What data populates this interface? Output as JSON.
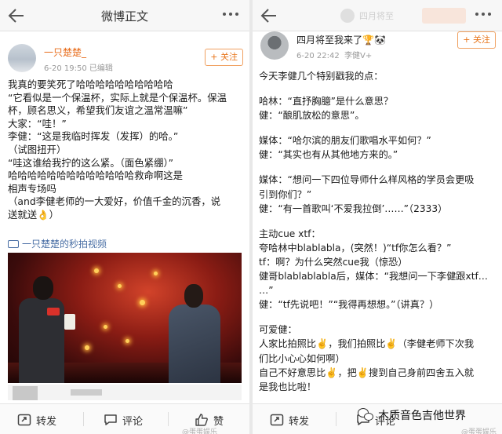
{
  "left": {
    "header": {
      "title": "微博正文"
    },
    "author": {
      "name": "一只楚楚_",
      "time": "6-20 19:50",
      "edited": "已编辑",
      "follow": "+ 关注"
    },
    "post_lines": [
      "我真的要笑死了哈哈哈哈哈哈哈哈哈哈",
      "“它看似是一个保温杯，实际上就是个保温杯。保温",
      "杯，顾名思义，希望我们友谊之温常温嘛”",
      "大家：“哇！”",
      "李健：“这是我临时挥发（发挥）的哈。”",
      "（试图扭开）",
      "“哇这谁给我拧的这么紧。（面色紧绷）”",
      "哈哈哈哈哈哈哈哈哈哈哈哈哈救命啊这是",
      "相声专场吗",
      "（and李健老师的一大爱好，价值千金的沉香，说",
      "送就送👌）"
    ],
    "video_link": "一只楚楚的秒拍视频",
    "actions": {
      "repost": "转发",
      "comment": "评论",
      "like": "赞"
    },
    "watermark": "@蛋蛋娱乐"
  },
  "right": {
    "header": {
      "user_blur": "四月将至"
    },
    "author": {
      "name": "四月将至我来了🏆🐼",
      "time": "6-20 22:42",
      "source": "李健V+",
      "follow": "+ 关注"
    },
    "paragraphs": [
      [
        "今天李健几个特别戳我的点："
      ],
      [
        "哈林：“直抒胸臆”是什么意思？",
        "健：“酿肌放松的意思”。"
      ],
      [
        "媒体：“哈尔滨的朋友们歌唱水平如何？”",
        "健：“其实也有从其他地方来的。”"
      ],
      [
        "媒体：“想问一下四位导师什么样风格的学员会更吸",
        "引到你们？”",
        "健：“有一首歌叫‘不爱我拉倒’……”（2333）"
      ],
      [
        "主动cue xtf：",
        "夸哈林中blablabla，(突然！)“tf你怎么看？”",
        "tf：啊？为什么突然cue我（惊恐）",
        "健哥blablablabla后，媒体：“我想问一下李健跟xtf…",
        "…”",
        "健：“tf先说吧！”“我得再想想。”（讲真？）"
      ],
      [
        "可爱健：",
        "人家比拍照比✌️，我们拍照比✌️（李健老师下次我",
        "们比小心心如何啊）",
        "自己不好意思比✌️，把✌️搜到自己身前四舍五入就",
        "是我也比啦！"
      ]
    ],
    "actions": {
      "repost": "转发",
      "comment": "评论"
    },
    "watermark": "@蛋蛋娱乐",
    "wechat_brand": "木质音色吉他世界"
  }
}
